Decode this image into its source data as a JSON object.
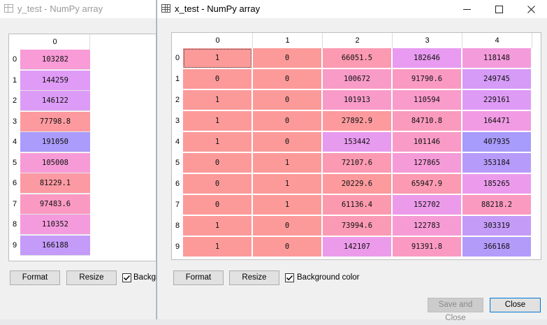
{
  "back_window": {
    "title": "y_test - NumPy array",
    "column_header": "0",
    "rows": [
      {
        "index": "0",
        "value": "103282",
        "color": "#f89bd6"
      },
      {
        "index": "1",
        "value": "144259",
        "color": "#df9bf6"
      },
      {
        "index": "2",
        "value": "146122",
        "color": "#dc9bf6"
      },
      {
        "index": "3",
        "value": "77798.8",
        "color": "#fc9a9f"
      },
      {
        "index": "4",
        "value": "191050",
        "color": "#ab9bfb"
      },
      {
        "index": "5",
        "value": "105008",
        "color": "#f79bd6"
      },
      {
        "index": "6",
        "value": "81229.1",
        "color": "#fc9aa4"
      },
      {
        "index": "7",
        "value": "97483.6",
        "color": "#fa9ac2"
      },
      {
        "index": "8",
        "value": "110352",
        "color": "#f49bdd"
      },
      {
        "index": "9",
        "value": "166188",
        "color": "#c49bf9"
      }
    ],
    "format_label": "Format",
    "resize_label": "Resize",
    "background_label": "Backgr"
  },
  "front_window": {
    "title": "x_test - NumPy array",
    "column_headers": [
      "0",
      "1",
      "2",
      "3",
      "4"
    ],
    "row_headers": [
      "0",
      "1",
      "2",
      "3",
      "4",
      "5",
      "6",
      "7",
      "8",
      "9"
    ],
    "cells": [
      [
        {
          "v": "1",
          "c": "#fc9a9a"
        },
        {
          "v": "0",
          "c": "#fc9a9a"
        },
        {
          "v": "66051.5",
          "c": "#fb9ab0"
        },
        {
          "v": "182646",
          "c": "#e89bf0"
        },
        {
          "v": "118148",
          "c": "#f49bdc"
        }
      ],
      [
        {
          "v": "0",
          "c": "#fc9a9a"
        },
        {
          "v": "0",
          "c": "#fc9a9a"
        },
        {
          "v": "100672",
          "c": "#f99bc7"
        },
        {
          "v": "91790.6",
          "c": "#fa9ac2"
        },
        {
          "v": "249745",
          "c": "#d59bf7"
        }
      ],
      [
        {
          "v": "1",
          "c": "#fc9a9a"
        },
        {
          "v": "0",
          "c": "#fc9a9a"
        },
        {
          "v": "101913",
          "c": "#f89bc9"
        },
        {
          "v": "110594",
          "c": "#f99bcb"
        },
        {
          "v": "229161",
          "c": "#de9bf5"
        }
      ],
      [
        {
          "v": "1",
          "c": "#fc9a9a"
        },
        {
          "v": "0",
          "c": "#fc9a9a"
        },
        {
          "v": "27892.9",
          "c": "#fc9a9e"
        },
        {
          "v": "84710.8",
          "c": "#fa9abd"
        },
        {
          "v": "164471",
          "c": "#f19be4"
        }
      ],
      [
        {
          "v": "1",
          "c": "#fc9a9a"
        },
        {
          "v": "0",
          "c": "#fc9a9a"
        },
        {
          "v": "153442",
          "c": "#e79bee"
        },
        {
          "v": "101146",
          "c": "#f99bc6"
        },
        {
          "v": "407935",
          "c": "#a79bfb"
        }
      ],
      [
        {
          "v": "0",
          "c": "#fc9a9a"
        },
        {
          "v": "1",
          "c": "#fc9a9a"
        },
        {
          "v": "72107.6",
          "c": "#fb9ab2"
        },
        {
          "v": "127865",
          "c": "#f59bd8"
        },
        {
          "v": "353184",
          "c": "#b69bfa"
        }
      ],
      [
        {
          "v": "0",
          "c": "#fc9a9a"
        },
        {
          "v": "1",
          "c": "#fc9a9a"
        },
        {
          "v": "20229.6",
          "c": "#fc9a9d"
        },
        {
          "v": "65947.9",
          "c": "#fb9ab2"
        },
        {
          "v": "185265",
          "c": "#ec9bec"
        }
      ],
      [
        {
          "v": "0",
          "c": "#fc9a9a"
        },
        {
          "v": "1",
          "c": "#fc9a9a"
        },
        {
          "v": "61136.4",
          "c": "#fb9aae"
        },
        {
          "v": "152702",
          "c": "#ec9bea"
        },
        {
          "v": "88218.2",
          "c": "#fa9ac0"
        }
      ],
      [
        {
          "v": "1",
          "c": "#fc9a9a"
        },
        {
          "v": "0",
          "c": "#fc9a9a"
        },
        {
          "v": "73994.6",
          "c": "#fb9ab4"
        },
        {
          "v": "122783",
          "c": "#f69bd4"
        },
        {
          "v": "303319",
          "c": "#c59bf8"
        }
      ],
      [
        {
          "v": "1",
          "c": "#fc9a9a"
        },
        {
          "v": "0",
          "c": "#fc9a9a"
        },
        {
          "v": "142107",
          "c": "#ec9bea"
        },
        {
          "v": "91391.8",
          "c": "#fa9ac2"
        },
        {
          "v": "366168",
          "c": "#b39bfa"
        }
      ]
    ],
    "format_label": "Format",
    "resize_label": "Resize",
    "background_label": "Background color",
    "save_close_label": "Save and Close",
    "close_label": "Close"
  }
}
